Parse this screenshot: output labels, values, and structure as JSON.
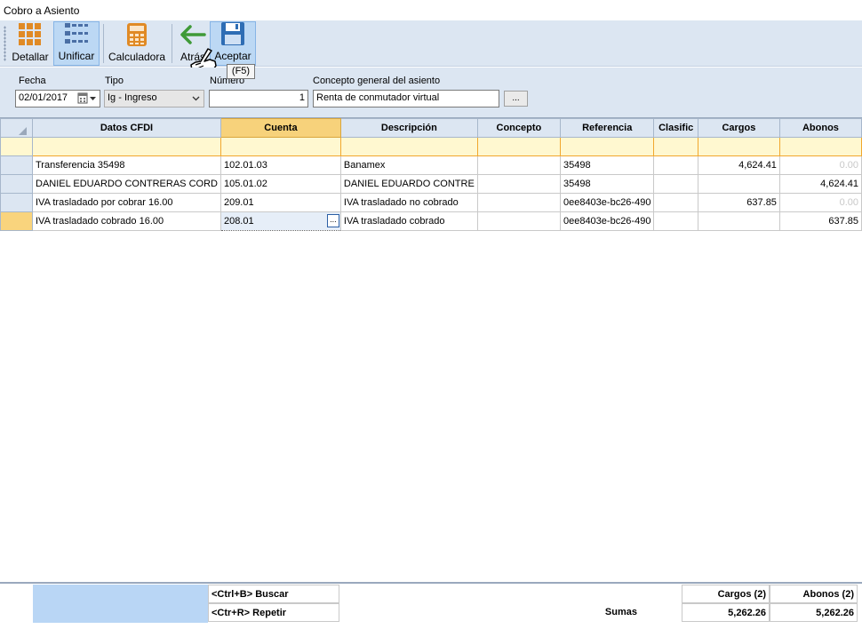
{
  "window": {
    "title": "Cobro a Asiento"
  },
  "toolbar": {
    "detallar": "Detallar",
    "unificar": "Unificar",
    "calculadora": "Calculadora",
    "atras": "Atrás",
    "aceptar": "Aceptar",
    "aceptar_tooltip": "(F5)",
    "icons": {
      "detallar": "grid-icon",
      "unificar": "list-icon",
      "calculadora": "calculator-icon",
      "atras": "arrow-left-icon",
      "aceptar": "floppy-disk-icon"
    },
    "colors": {
      "detallar_icon": "#e08a25",
      "unificar_icon": "#4a6fa5",
      "calculadora_icon": "#e08a25",
      "atras_icon": "#3f9a38",
      "aceptar_icon": "#2e6db4"
    }
  },
  "form": {
    "fecha_label": "Fecha",
    "fecha_value": "02/01/2017",
    "tipo_label": "Tipo",
    "tipo_value": "Ig - Ingreso",
    "numero_label": "Número",
    "numero_value": "1",
    "concepto_label": "Concepto general del asiento",
    "concepto_value": "Renta de conmutador virtual",
    "concepto_button": "..."
  },
  "grid": {
    "columns": [
      "Datos CFDI",
      "Cuenta",
      "Descripción",
      "Concepto",
      "Referencia",
      "Clasific",
      "Cargos",
      "Abonos"
    ],
    "selected_column": "Cuenta",
    "rows": [
      {
        "datos": "Transferencia 35498",
        "cuenta": "102.01.03",
        "descripcion": "Banamex",
        "concepto": "",
        "referencia": "35498",
        "clasific": "",
        "cargos": "4,624.41",
        "abonos": "0.00"
      },
      {
        "datos": "DANIEL  EDUARDO CONTRERAS  CORD",
        "cuenta": "105.01.02",
        "descripcion": "DANIEL  EDUARDO CONTRE",
        "concepto": "",
        "referencia": "35498",
        "clasific": "",
        "cargos": "",
        "abonos": "4,624.41"
      },
      {
        "datos": "IVA trasladado por cobrar 16.00",
        "cuenta": "209.01",
        "descripcion": "IVA trasladado no cobrado",
        "concepto": "",
        "referencia": "0ee8403e-bc26-490",
        "clasific": "",
        "cargos": "637.85",
        "abonos": "0.00"
      },
      {
        "datos": "IVA trasladado cobrado 16.00",
        "cuenta": "208.01",
        "descripcion": "IVA trasladado cobrado",
        "concepto": "",
        "referencia": "0ee8403e-bc26-490",
        "clasific": "",
        "cargos": "",
        "abonos": "637.85"
      }
    ],
    "cell_button": "..."
  },
  "footer": {
    "buscar": "<Ctrl+B> Buscar",
    "repetir": "<Ctr+R> Repetir",
    "sumas_label": "Sumas",
    "cargos_header": "Cargos (2)",
    "abonos_header": "Abonos (2)",
    "cargos_total": "5,262.26",
    "abonos_total": "5,262.26"
  }
}
